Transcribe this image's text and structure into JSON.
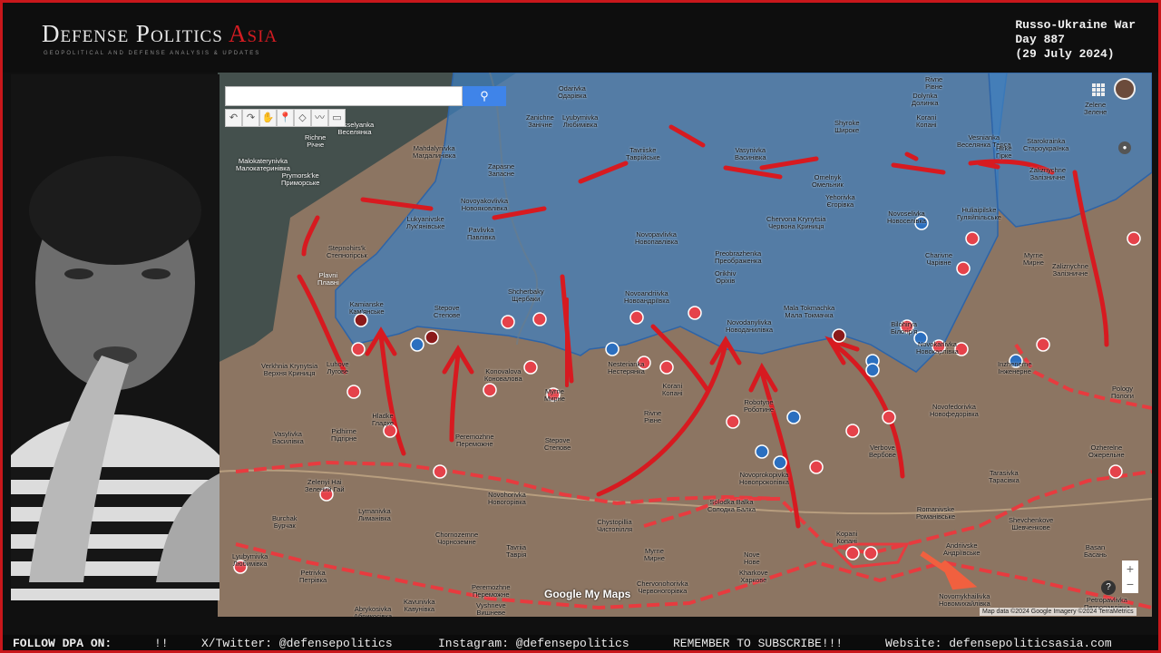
{
  "brand": {
    "name_main": "Defense Politics ",
    "name_accent": "Asia",
    "tagline": "GEOPOLITICAL AND DEFENSE ANALYSIS & UPDATES"
  },
  "war_info": {
    "line1": "Russo-Ukraine War",
    "line2": "Day 887",
    "line3": "(29 July 2024)"
  },
  "map": {
    "search_placeholder": "",
    "search_icon": "magnifier-icon",
    "tools": [
      "↶",
      "↷",
      "✋",
      "📍",
      "◇",
      "〰",
      "▭"
    ],
    "zoom_in": "+",
    "zoom_out": "−",
    "help": "?",
    "attribution": "Map data ©2024 Google Imagery ©2024 TerraMetrics",
    "logo": "Google My Maps",
    "colors": {
      "occupied": "#3f7fbf",
      "frontline": "#e02127",
      "terrain": "#8c7562",
      "water": "#44504d"
    },
    "places": [
      {
        "name": "Odarivka\nОдарівка"
      },
      {
        "name": "Vesselyanka\nВеселянка"
      },
      {
        "name": "Richne\nРічне"
      },
      {
        "name": "Malokaterynivka\nМалокатеринівка"
      },
      {
        "name": "Prymorsk'ke\nПриморське"
      },
      {
        "name": "Zanichne\nЗанічне"
      },
      {
        "name": "Lyubymivka\nЛюбимівка"
      },
      {
        "name": "Tavriiske\nТаврійське"
      },
      {
        "name": "Vasynivka\nВасинівка"
      },
      {
        "name": "Shyroke\nШироке"
      },
      {
        "name": "Korani\nКопані"
      },
      {
        "name": "Dolynka\nДолинка"
      },
      {
        "name": "Rivne\nРівне"
      },
      {
        "name": "Vesnianka\nВеселянка Терса"
      },
      {
        "name": "Zelene\nЗелене"
      },
      {
        "name": "Mahdalynivka\nМагдалинівка"
      },
      {
        "name": "Zapasne\nЗапасне"
      },
      {
        "name": "Omelnyk\nОмельник"
      },
      {
        "name": "Starokrainka\nСтароукраїнка"
      },
      {
        "name": "Hirke\nГірке"
      },
      {
        "name": "Zaliznychne\nЗалізничне"
      },
      {
        "name": "Novoyakovlivka\nНовояковлівка"
      },
      {
        "name": "Yehorivka\nЄгорівка"
      },
      {
        "name": "Lukyanivske\nЛук'янівське"
      },
      {
        "name": "Pavlivka\nПавлівка"
      },
      {
        "name": "Novoselivka\nНовоселівка"
      },
      {
        "name": "Huliaipilske\nГуляйпільське"
      },
      {
        "name": "Stepnohirs'k\nСтепногірськ"
      },
      {
        "name": "Novopavlivka\nНовопавлівка"
      },
      {
        "name": "Chervona Krynytsia\nЧервона Криниця"
      },
      {
        "name": "Plavni\nПлавні"
      },
      {
        "name": "Preobrazhenka\nПреображенка"
      },
      {
        "name": "Charivne\nЧарівне"
      },
      {
        "name": "Myrne\nМирне"
      },
      {
        "name": "Zaliznychne\nЗалізничне"
      },
      {
        "name": "Shcherbaky\nЩербаки"
      },
      {
        "name": "Orikhiv\nОріхів"
      },
      {
        "name": "Kamianske\nКам'янське"
      },
      {
        "name": "Stepove\nСтепове"
      },
      {
        "name": "Novoandriivka\nНовоандріївка"
      },
      {
        "name": "Mala Tokmachka\nМала Токмачка"
      },
      {
        "name": "Novodanylivka\nНоводанилівка"
      },
      {
        "name": "Bilohirya\nБілогір'я"
      },
      {
        "name": "Novokarlivka\nНовокарлівка"
      },
      {
        "name": "Inzhenerne\nІнженерне"
      },
      {
        "name": "Pology\nПологи"
      },
      {
        "name": "Verkhnia Krynytsia\nВерхня Криниця"
      },
      {
        "name": "Luhove\nЛугове"
      },
      {
        "name": "Konovalova\nКоновалова"
      },
      {
        "name": "Nesterianka\nНестерянка"
      },
      {
        "name": "Robotyne\nРоботине"
      },
      {
        "name": "Myrne\nМирне"
      },
      {
        "name": "Novofedorivka\nНовофедорівка"
      },
      {
        "name": "Vasylivka\nВасилівка"
      },
      {
        "name": "Hladke\nГладке"
      },
      {
        "name": "Pidhirne\nПідгірне"
      },
      {
        "name": "Rivne\nРівне"
      },
      {
        "name": "Korani\nКопані"
      },
      {
        "name": "Verbove\nВербове"
      },
      {
        "name": "Peremozhne\nПереможне"
      },
      {
        "name": "Stepove\nСтепове"
      },
      {
        "name": "Novoprokopivka\nНовопрокопівка"
      },
      {
        "name": "Tarasivka\nТарасівка"
      },
      {
        "name": "Ozherelne\nОжерельне"
      },
      {
        "name": "Zelenyi Hai\nЗелений Гай"
      },
      {
        "name": "Solodka Balka\nСолодка Балка"
      },
      {
        "name": "Romanivske\nРоманівське"
      },
      {
        "name": "Burchak\nБурчак"
      },
      {
        "name": "Lymanivka\nЛиманівка"
      },
      {
        "name": "Novohorivka\nНовогорівка"
      },
      {
        "name": "Chystopillia\nЧистопілля"
      },
      {
        "name": "Shevchenkove\nШевченкове"
      },
      {
        "name": "Chornozemne\nЧорноземне"
      },
      {
        "name": "Tavriia\nТаврія"
      },
      {
        "name": "Myrne\nМирне"
      },
      {
        "name": "Kopani\nКопані"
      },
      {
        "name": "Andriivske\nАндріївське"
      },
      {
        "name": "Basan\nБасань"
      },
      {
        "name": "Petrivka\nПетрівка"
      },
      {
        "name": "Lyubymivka\nЛюбимівка"
      },
      {
        "name": "Nove\nНове"
      },
      {
        "name": "Kharkove\nХаркове"
      },
      {
        "name": "Chervonohorivka\nЧервоногорівка"
      },
      {
        "name": "Novomykhailivka\nНовомихайлівка"
      },
      {
        "name": "Petropavlivka\nПетропавлівка"
      },
      {
        "name": "Peremozhne\nПереможне"
      },
      {
        "name": "Vyshneve\nВишневе"
      },
      {
        "name": "Kavunivka\nКавунівка"
      },
      {
        "name": "Abrykosivka\nАбрикосівка"
      }
    ]
  },
  "footer": {
    "follow": "FOLLOW DPA ON:",
    "arrows": "!!",
    "twitter": "X/Twitter: @defensepolitics",
    "instagram": "Instagram: @defensepolitics",
    "subscribe": "REMEMBER TO SUBSCRIBE!!!",
    "website": "Website: defensepoliticsasia.com"
  }
}
